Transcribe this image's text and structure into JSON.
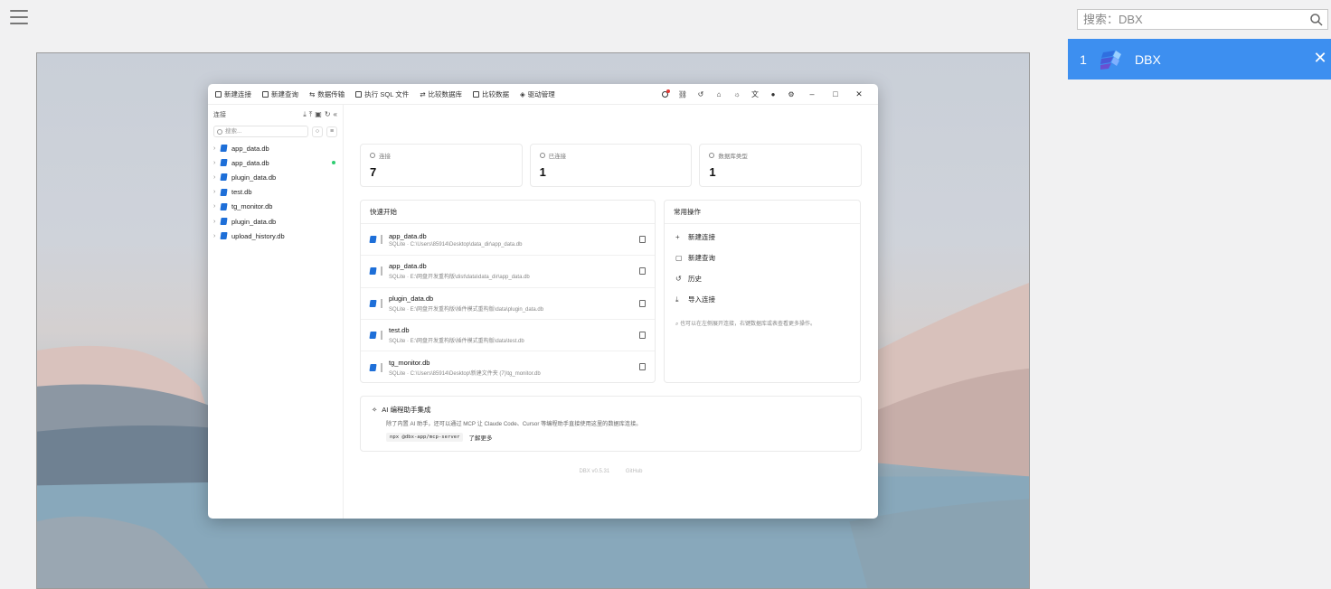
{
  "search": {
    "placeholder": "搜索：DBX"
  },
  "task_list": [
    {
      "index": "1",
      "name": "DBX"
    }
  ],
  "app": {
    "toolbar": {
      "items": [
        "新建连接",
        "新建查询",
        "数据传输",
        "执行 SQL 文件",
        "比较数据库",
        "比较数据",
        "驱动管理"
      ]
    },
    "sidebar": {
      "title": "连接",
      "search_placeholder": "搜索...",
      "connections": [
        "app_data.db",
        "app_data.db",
        "plugin_data.db",
        "test.db",
        "tg_monitor.db",
        "plugin_data.db",
        "upload_history.db"
      ]
    },
    "stats": [
      {
        "label": "连接",
        "value": "7"
      },
      {
        "label": "已连接",
        "value": "1"
      },
      {
        "label": "数据库类型",
        "value": "1"
      }
    ],
    "quick_start": {
      "title": "快速开始",
      "items": [
        {
          "name": "app_data.db",
          "path": "SQLite · C:\\Users\\85914\\Desktop\\data_dir\\app_data.db"
        },
        {
          "name": "app_data.db",
          "path": "SQLite · E:\\网盘开发重构版\\dist\\data\\data_dir\\app_data.db"
        },
        {
          "name": "plugin_data.db",
          "path": "SQLite · E:\\网盘开发重构版\\插件模式重构版\\data\\plugin_data.db"
        },
        {
          "name": "test.db",
          "path": "SQLite · E:\\网盘开发重构版\\插件模式重构版\\data\\test.db"
        },
        {
          "name": "tg_monitor.db",
          "path": "SQLite · C:\\Users\\85914\\Desktop\\新建文件夹 (7)\\tg_monitor.db"
        }
      ]
    },
    "common_actions": {
      "title": "常用操作",
      "items": [
        "新建连接",
        "新建查询",
        "历史",
        "导入连接"
      ],
      "hint": "也可以在左侧展开连接，右键数据库或表查看更多操作。"
    },
    "ai": {
      "title": "AI 编程助手集成",
      "desc": "除了内置 AI 助手，还可以通过 MCP 让 Claude Code、Cursor 等编程助手直接使用这里的数据库连接。",
      "code": "npx @dbx-app/mcp-server",
      "more": "了解更多"
    },
    "footer": {
      "version": "DBX v0.5.31",
      "link": "GitHub"
    }
  }
}
